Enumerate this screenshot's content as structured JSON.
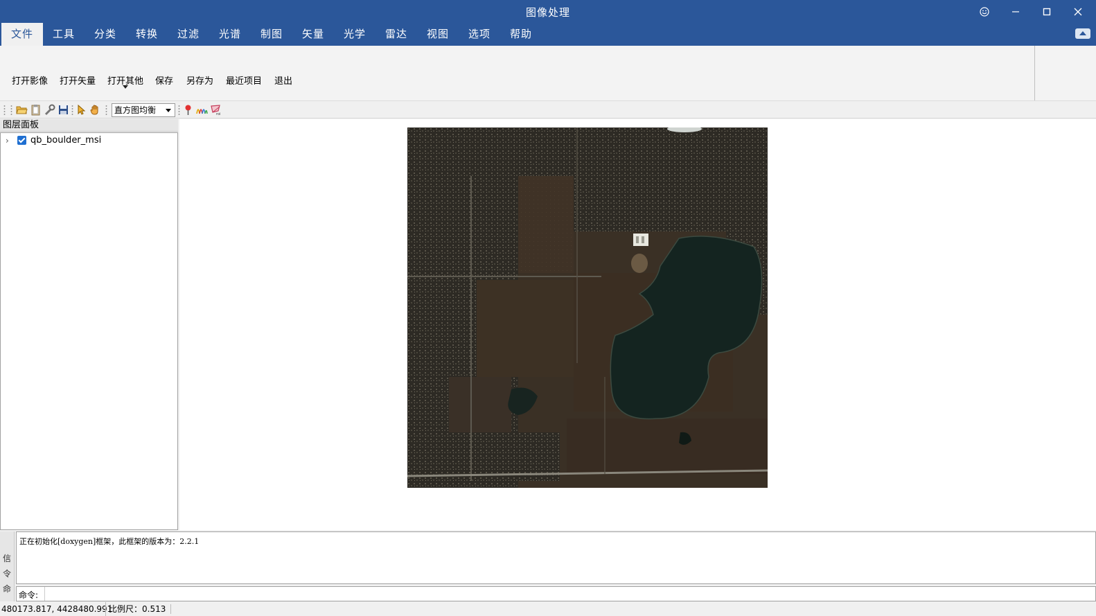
{
  "window": {
    "title": "图像处理",
    "controls": [
      "smiley",
      "minimize",
      "maximize",
      "close"
    ]
  },
  "menu": {
    "tabs": [
      {
        "label": "文件",
        "active": true
      },
      {
        "label": "工具"
      },
      {
        "label": "分类"
      },
      {
        "label": "转换"
      },
      {
        "label": "过滤"
      },
      {
        "label": "光谱"
      },
      {
        "label": "制图"
      },
      {
        "label": "矢量"
      },
      {
        "label": "光学"
      },
      {
        "label": "雷达"
      },
      {
        "label": "视图"
      },
      {
        "label": "选项"
      },
      {
        "label": "帮助"
      }
    ]
  },
  "ribbon": {
    "buttons": [
      {
        "label": "打开影像"
      },
      {
        "label": "打开矢量"
      },
      {
        "label": "打开其他",
        "has_dropdown": true
      },
      {
        "label": "保存"
      },
      {
        "label": "另存为"
      },
      {
        "label": "最近项目"
      },
      {
        "label": "退出"
      }
    ]
  },
  "toolbar": {
    "icons": [
      "open-folder-icon",
      "clipboard-icon",
      "wrench-icon",
      "save-disk-icon",
      "pointer-icon",
      "hand-pan-icon",
      "pin-marker-icon",
      "spectral-profile-icon",
      "roi-icon"
    ],
    "stretch_select": "直方图均衡"
  },
  "layer_panel": {
    "title": "图层面板",
    "layers": [
      {
        "name": "qb_boulder_msi",
        "checked": true
      }
    ]
  },
  "console": {
    "output_line": "正在初始化[doxygen]框架，此框架的版本为：2.2.1",
    "side_label": [
      "信",
      "令",
      "命"
    ],
    "prompt": "命令:"
  },
  "status": {
    "coords": "480173.817, 4428480.991",
    "scale": "比例尺：0.513"
  },
  "colors": {
    "title_bar": "#2b579a",
    "background": "#f0f0f0",
    "accent_check": "#1f6fd1"
  }
}
